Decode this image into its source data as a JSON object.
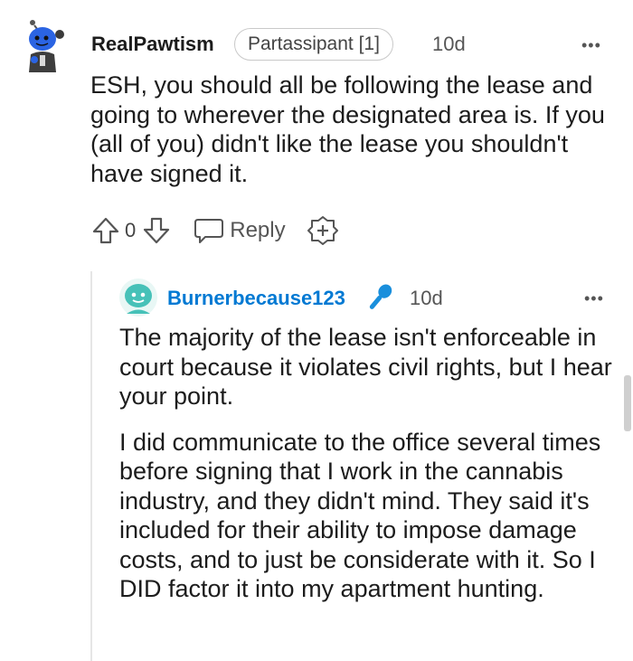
{
  "comment": {
    "author": "RealPawtism",
    "flair": "Partassipant [1]",
    "time": "10d",
    "more": "•••",
    "body": "ESH, you should all be following the lease and going to wherever the designated area is. If you (all of you) didn't like the lease you shouldn't have signed it.",
    "score": "0",
    "reply_label": "Reply"
  },
  "reply": {
    "author": "Burnerbecause123",
    "time": "10d",
    "more": "•••",
    "paragraphs": [
      "The majority of the lease isn't enforceable in court because it violates civil rights, but I hear your point.",
      "I did communicate to the office several times before signing that I work in the cannabis industry, and they didn't mind. They said it's included for their ability to impose damage costs, and to just be considerate with it. So I DID factor it into my apartment hunting."
    ]
  },
  "colors": {
    "reply_author": "#0079d3",
    "avatar_top": "#2b64e3",
    "avatar_reply": "#46c1b8",
    "mod_icon": "#1a8fdc"
  },
  "icons": [
    "avatar",
    "upvote-icon",
    "downvote-icon",
    "reply-icon",
    "award-icon",
    "microphone-icon",
    "more-icon"
  ]
}
